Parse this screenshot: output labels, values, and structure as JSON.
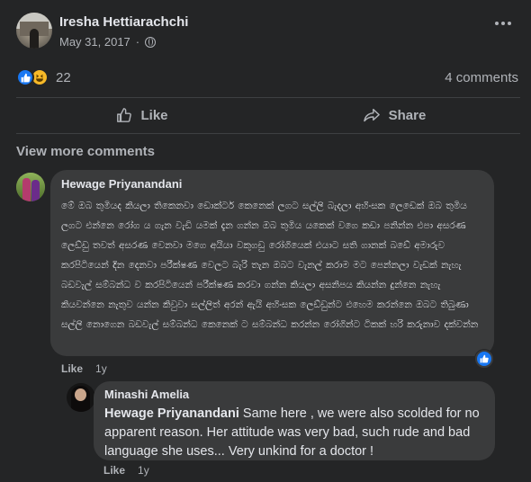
{
  "post": {
    "author": "Iresha Hettiarachchi",
    "date": "May 31, 2017",
    "reactions": {
      "count": "22",
      "types": [
        "like-icon",
        "haha-icon"
      ]
    },
    "comments_count": "4 comments"
  },
  "actions": {
    "like": "Like",
    "share": "Share"
  },
  "view_more": "View more comments",
  "comments": [
    {
      "author": "Hewage Priyanandani",
      "text": "මේ ඔබ තුමියද කියලා තිකෙනවා ඩොක්ටර් කෙනෙක් ලගට සල්ලි බැදලා අහිංසක ලෙඩෙක් ඔබ තුමිය ලගට එන්නෙ රෝග ය ගැන වැඩි යමක් දැන ගන්න ඔබ තුමිය යකෙක් වගෙ කඩා පනින්න එපා අසරණ ලෙඩ්ඩු තවත් අසරණ වෙනවා මගෙ අයියා වකුගඩු රෝගියෙක් එයාට සති ගානක් බඩේ අමාරුව කරපිටියෙන් දින දෙනවා පරීක්ෂණ වෙලට බැරි තැන ඔබට වැනල් කරාම මට පෙන්නලා වැඩක් නැහැ බඩවැල් සම්බන්ධ ව කරපිටියෙන් පරීක්ෂණ කරවා ගන්න කියලා අසනිපය කියන්න දුන්නෙ නැහැ කියවන්නෙ නැතුව යන්න කිවුවා සල්ලිත් අරන් ඇයි අහිංසක ලෙඩ්ඩුන්ට එහෙම කරන්නෙ ඔබට තිබුණා සල්ලි නොගෙන බඩවැල් සම්බන්ධ කෙනෙක් ට සම්බන්ධ කරන්න රෝගින්ට ටිකක් හරි කරුනාව දක්වන්න",
      "like_label": "Like",
      "time": "1y"
    },
    {
      "author": "Minashi Amelia",
      "mention": "Hewage Priyanandani",
      "text": " Same here , we were also scolded for no apparent reason. Her attitude was very bad, such rude and bad language she uses... Very unkind for a doctor !",
      "like_label": "Like",
      "time": "1y"
    }
  ],
  "colors": {
    "background": "#242526",
    "bubble": "#3a3b3c",
    "like_blue": "#1877f2",
    "haha_yellow": "#f7b928"
  }
}
